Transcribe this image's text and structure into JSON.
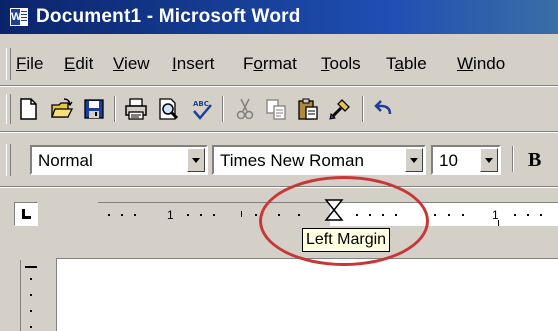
{
  "window": {
    "title": "Document1 - Microsoft Word"
  },
  "menubar": {
    "items": [
      {
        "pre": "",
        "u": "F",
        "post": "ile"
      },
      {
        "pre": "",
        "u": "E",
        "post": "dit"
      },
      {
        "pre": "",
        "u": "V",
        "post": "iew"
      },
      {
        "pre": "",
        "u": "I",
        "post": "nsert"
      },
      {
        "pre": "F",
        "u": "o",
        "post": "rmat"
      },
      {
        "pre": "",
        "u": "T",
        "post": "ools"
      },
      {
        "pre": "T",
        "u": "a",
        "post": "ble"
      },
      {
        "pre": "",
        "u": "W",
        "post": "indo"
      }
    ]
  },
  "toolbar": {
    "icons": [
      "new-document-icon",
      "open-folder-icon",
      "save-icon",
      "print-icon",
      "print-preview-icon",
      "spelling-icon",
      "cut-icon",
      "copy-icon",
      "paste-icon",
      "format-painter-icon",
      "undo-icon"
    ]
  },
  "formatting": {
    "style": "Normal",
    "font": "Times New Roman",
    "size": "10",
    "bold_label": "B"
  },
  "ruler": {
    "numbers": [
      "1",
      "1"
    ],
    "tooltip": "Left Margin"
  },
  "colors": {
    "title_bar": "#0a246a",
    "face": "#d4d0c8",
    "highlight": "#c83737",
    "tooltip_bg": "#ffffe1"
  }
}
